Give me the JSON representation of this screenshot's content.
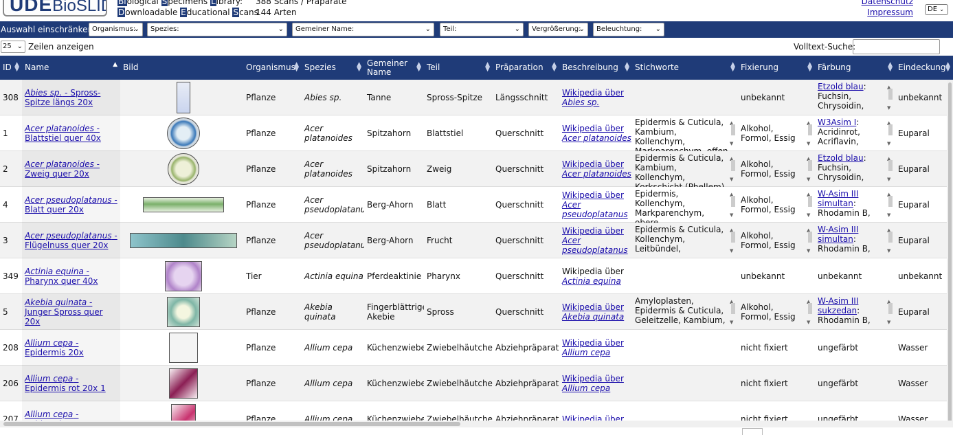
{
  "header": {
    "logo_part1": "UDE",
    "logo_part2": "BioSLIDES",
    "tagline_line1": [
      "Bi",
      "o",
      "logical ",
      "S",
      "pecimens ",
      "L",
      "ibrary:"
    ],
    "tagline_line2": [
      "D",
      "ownloadable ",
      "E",
      "ducational ",
      "S",
      "cans"
    ],
    "stat_scans": "388 Scans / Präparate",
    "stat_species": "144 Arten",
    "link_privacy": "Datenschutz",
    "link_imprint": "Impressum",
    "language": "DE"
  },
  "filters": {
    "label": "Auswahl einschränken:",
    "organismus": "Organismus:",
    "spezies": "Spezies:",
    "gemeiner_name": "Gemeiner Name:",
    "teil": "Teil:",
    "vergroesserung": "Vergrößerung:",
    "beleuchtung": "Beleuchtung:"
  },
  "controls": {
    "rows_value": "25",
    "rows_label": "Zeilen anzeigen",
    "search_label": "Volltext-Suche:"
  },
  "columns": [
    "ID",
    "Name",
    "Bild",
    "Organismus",
    "Spezies",
    "Gemeiner Name",
    "Teil",
    "Präparation",
    "Beschreibung",
    "Stichworte",
    "Fixierung",
    "Färbung",
    "Eindeckung"
  ],
  "rows": [
    {
      "id": "308",
      "name_species": "Abies sp.",
      "name_rest": " - Spross-Spitze längs 20x",
      "org": "Pflanze",
      "species": "Abies sp.",
      "common": "Tanne",
      "part": "Spross-Spitze",
      "prep": "Längsschnitt",
      "desc_prefix": "Wikipedia über",
      "desc_link_prefix": true,
      "desc_link": "Abies sp.",
      "keywords": "",
      "fix": "unbekannt",
      "stain_link": "Etzold blau",
      "stain_rest": ": Fuchsin, Chrysoidin,",
      "mount": "unbekannt"
    },
    {
      "id": "1",
      "name_species": "Acer platanoides",
      "name_rest": " - Blattstiel quer 40x",
      "org": "Pflanze",
      "species": "Acer platanoides",
      "common": "Spitzahorn",
      "part": "Blattstiel",
      "prep": "Querschnitt",
      "desc_prefix": "Wikipedia über",
      "desc_link_prefix": true,
      "desc_link": "Acer platanoides",
      "keywords": "Epidermis & Cuticula, Kambium, Kollenchym, Markparenchym, offen",
      "fix": "Alkohol, Formol, Essig",
      "stain_link": "W3Asim I",
      "stain_rest": ": Acridinrot, Acriflavin,",
      "mount": "Euparal"
    },
    {
      "id": "2",
      "name_species": "Acer platanoides",
      "name_rest": " - Zweig quer 20x",
      "org": "Pflanze",
      "species": "Acer platanoides",
      "common": "Spitzahorn",
      "part": "Zweig",
      "prep": "Querschnitt",
      "desc_prefix": "Wikipedia über",
      "desc_link_prefix": true,
      "desc_link": "Acer platanoides",
      "keywords": "Epidermis & Cuticula, Kambium, Kollenchym, Korkschicht (Phellem),",
      "fix": "Alkohol, Formol, Essig",
      "stain_link": "Etzold blau",
      "stain_rest": ": Fuchsin, Chrysoidin,",
      "mount": "Euparal"
    },
    {
      "id": "4",
      "name_species": "Acer pseudoplatanus",
      "name_rest": " - Blatt quer 20x",
      "org": "Pflanze",
      "species": "Acer pseudoplatanus",
      "common": "Berg-Ahorn",
      "part": "Blatt",
      "prep": "Querschnitt",
      "desc_prefix": "Wikipedia über",
      "desc_link_prefix": true,
      "desc_link": "Acer pseudoplatanus",
      "keywords": "Epidermis, Kollenchym, Markparenchym, obere",
      "fix": "Alkohol, Formol, Essig",
      "stain_link": "W-Asim III simultan",
      "stain_rest": ": Rhodamin B,",
      "mount": "Euparal"
    },
    {
      "id": "3",
      "name_species": "Acer pseudoplatanus",
      "name_rest": " - Flügelnuss quer 20x",
      "org": "Pflanze",
      "species": "Acer pseudoplatanus",
      "common": "Berg-Ahorn",
      "part": "Frucht",
      "prep": "Querschnitt",
      "desc_prefix": "Wikipedia über",
      "desc_link_prefix": true,
      "desc_link": "Acer pseudoplatanus",
      "keywords": "Epidermis & Cuticula, Kollenchym, Leitbündel,",
      "fix": "Alkohol, Formol, Essig",
      "stain_link": "W-Asim III simultan",
      "stain_rest": ": Rhodamin B,",
      "mount": "Euparal"
    },
    {
      "id": "349",
      "name_species": "Actinia equina",
      "name_rest": " - Pharynx quer 40x",
      "org": "Tier",
      "species": "Actinia equina",
      "common": "Pferdeaktinie",
      "part": "Pharynx",
      "prep": "Querschnitt",
      "desc_prefix": "Wikipedia über",
      "desc_link_prefix": false,
      "desc_link": "Actinia equina",
      "keywords": "",
      "fix": "unbekannt",
      "stain_link": "",
      "stain_rest": "unbekannt",
      "mount": "unbekannt"
    },
    {
      "id": "5",
      "name_species": "Akebia quinata",
      "name_rest": " - Junger Spross quer 20x",
      "org": "Pflanze",
      "species": "Akebia quinata",
      "common": "Fingerblättrige Akebie",
      "part": "Spross",
      "prep": "Querschnitt",
      "desc_prefix": "Wikipedia über",
      "desc_link_prefix": true,
      "desc_link": "Akebia quinata",
      "keywords": "Amyloplasten, Epidermis & Cuticula, Geleitzelle, Kambium,",
      "fix": "Alkohol, Formol, Essig",
      "stain_link": "W-Asim III sukzedan",
      "stain_rest": ": Rhodamin B,",
      "mount": "Euparal"
    },
    {
      "id": "208",
      "name_species": "Allium cepa",
      "name_rest": " - Epidermis 20x",
      "org": "Pflanze",
      "species": "Allium cepa",
      "common": "Küchenzwiebel",
      "part": "Zwiebelhäutchen",
      "prep": "Abziehpräparat",
      "desc_prefix": "Wikipedia über",
      "desc_link_prefix": true,
      "desc_link": "Allium cepa",
      "keywords": "",
      "fix": "nicht fixiert",
      "stain_link": "",
      "stain_rest": "ungefärbt",
      "mount": "Wasser"
    },
    {
      "id": "206",
      "name_species": "Allium cepa",
      "name_rest": " - Epidermis rot 20x 1",
      "org": "Pflanze",
      "species": "Allium cepa",
      "common": "Küchenzwiebel",
      "part": "Zwiebelhäutchen",
      "prep": "Abziehpräparat",
      "desc_prefix": "Wikipedia über",
      "desc_link_prefix": true,
      "desc_link": "Allium cepa",
      "keywords": "",
      "fix": "nicht fixiert",
      "stain_link": "",
      "stain_rest": "ungefärbt",
      "mount": "Wasser"
    },
    {
      "id": "207",
      "name_species": "Allium cepa",
      "name_rest": " - Epidermis",
      "org": "Pflanze",
      "species": "Allium cepa",
      "common": "Küchenzwiebel",
      "part": "Zwiebelhäutchen",
      "prep": "Abziehpräparat",
      "desc_prefix": "Wikipedia über",
      "desc_link_prefix": true,
      "desc_link": "",
      "keywords": "",
      "fix": "nicht fixiert",
      "stain_link": "",
      "stain_rest": "ungefärbt",
      "mount": "Wasser"
    }
  ],
  "colors": {
    "brand": "#1f3b78",
    "row_alt": "#f2f2f2",
    "link": "#1a0dab"
  }
}
